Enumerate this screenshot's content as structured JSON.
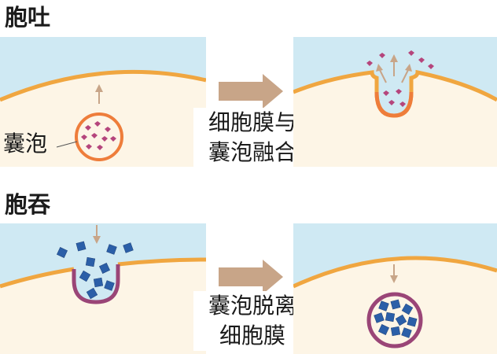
{
  "exocytosis": {
    "title": "胞吐",
    "vesicle_label": "囊泡",
    "step_caption_line1": "细胞膜与",
    "step_caption_line2": "囊泡融合"
  },
  "endocytosis": {
    "title": "胞吞",
    "step_caption_line1": "囊泡脱离",
    "step_caption_line2": "细胞膜"
  },
  "colors": {
    "cytoplasm": "#fdf5e6",
    "extracellular": "#cfe9f3",
    "exo_membrane": "#f0a640",
    "exo_vesicle": "#ee7d3b",
    "exo_cargo": "#b5457c",
    "endo_vesicle": "#9a4577",
    "endo_cargo": "#2b5fa8",
    "arrow": "#c8a588"
  }
}
